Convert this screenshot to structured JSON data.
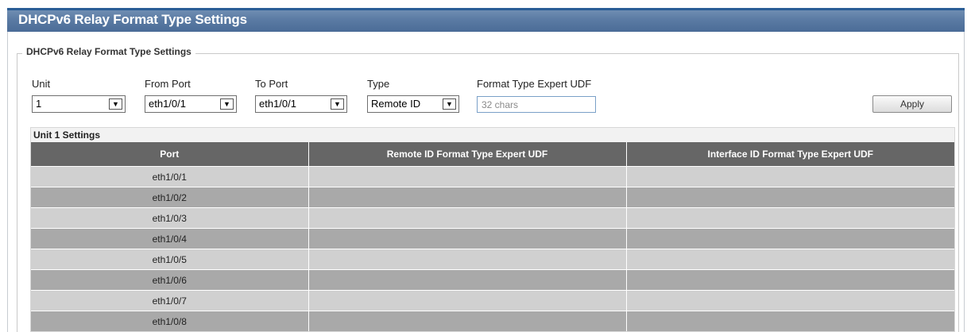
{
  "page": {
    "title": "DHCPv6 Relay Format Type Settings"
  },
  "form": {
    "legend": "DHCPv6 Relay Format Type Settings",
    "unit": {
      "label": "Unit",
      "value": "1"
    },
    "from_port": {
      "label": "From Port",
      "value": "eth1/0/1"
    },
    "to_port": {
      "label": "To Port",
      "value": "eth1/0/1"
    },
    "type": {
      "label": "Type",
      "value": "Remote ID"
    },
    "udf": {
      "label": "Format Type Expert UDF",
      "placeholder": "32 chars",
      "value": ""
    },
    "apply_label": "Apply"
  },
  "table": {
    "caption": "Unit 1 Settings",
    "headers": [
      "Port",
      "Remote ID Format Type Expert UDF",
      "Interface ID Format Type Expert UDF"
    ],
    "rows": [
      {
        "port": "eth1/0/1",
        "remote": "",
        "interface": ""
      },
      {
        "port": "eth1/0/2",
        "remote": "",
        "interface": ""
      },
      {
        "port": "eth1/0/3",
        "remote": "",
        "interface": ""
      },
      {
        "port": "eth1/0/4",
        "remote": "",
        "interface": ""
      },
      {
        "port": "eth1/0/5",
        "remote": "",
        "interface": ""
      },
      {
        "port": "eth1/0/6",
        "remote": "",
        "interface": ""
      },
      {
        "port": "eth1/0/7",
        "remote": "",
        "interface": ""
      },
      {
        "port": "eth1/0/8",
        "remote": "",
        "interface": ""
      }
    ]
  },
  "colors": {
    "title_bar": "#5a7aa3",
    "table_header": "#666666",
    "row_light": "#d0d0d0",
    "row_dark": "#a9a9a9"
  }
}
